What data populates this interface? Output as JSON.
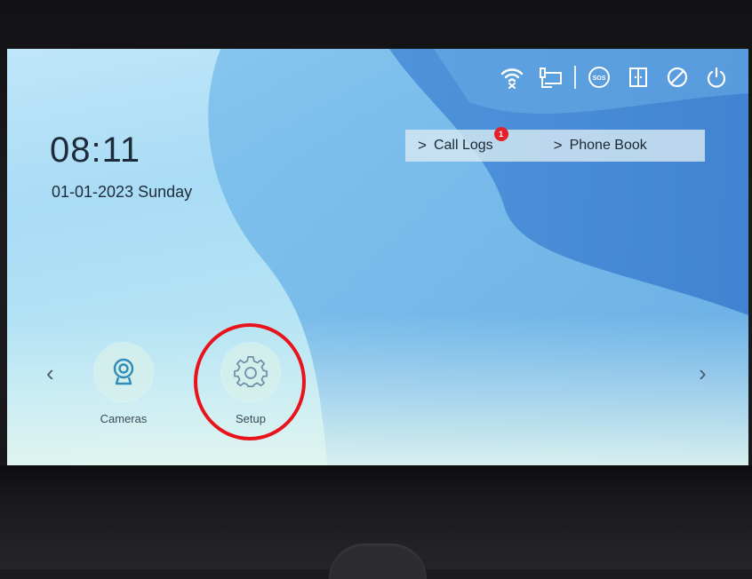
{
  "status_bar": {
    "icons": [
      "wifi-disconnected-icon",
      "ethernet-icon",
      "sos-icon",
      "door-icon",
      "do-not-disturb-icon",
      "power-icon"
    ],
    "sos_text": "SOS"
  },
  "home": {
    "time": "08:11",
    "date": "01-01-2023 Sunday"
  },
  "quick_links": {
    "call_logs": "Call Logs",
    "call_logs_badge": "1",
    "phone_book": "Phone Book"
  },
  "apps": [
    {
      "label": "Cameras",
      "icon": "camera-icon"
    },
    {
      "label": "Setup",
      "icon": "gear-icon"
    }
  ],
  "nav": {
    "prev": "‹",
    "next": "›"
  },
  "annotation": {
    "ring_color": "#e8141b"
  }
}
